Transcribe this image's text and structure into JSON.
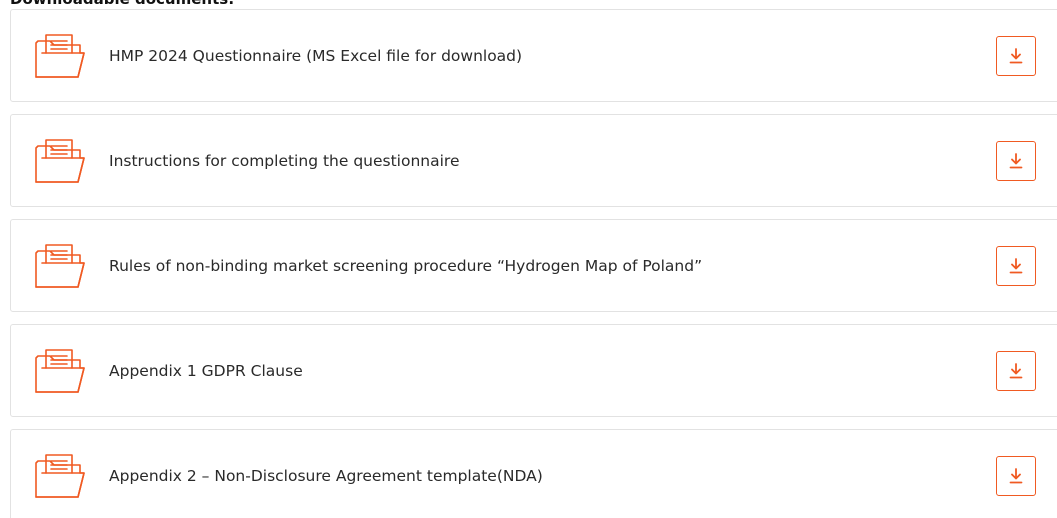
{
  "section": {
    "heading": "Downloadable documents:"
  },
  "theme": {
    "accent": "#f05a22",
    "border": "#e2e2e2"
  },
  "documents": [
    {
      "title": "HMP 2024 Questionnaire (MS Excel file for download)",
      "icon": "folder-document-icon",
      "action_icon": "download-icon"
    },
    {
      "title": "Instructions for completing the questionnaire",
      "icon": "folder-document-icon",
      "action_icon": "download-icon"
    },
    {
      "title": "Rules of non-binding market screening procedure “Hydrogen Map of Poland”",
      "icon": "folder-document-icon",
      "action_icon": "download-icon"
    },
    {
      "title": "Appendix 1 GDPR Clause",
      "icon": "folder-document-icon",
      "action_icon": "download-icon"
    },
    {
      "title": "Appendix 2 – Non-Disclosure Agreement template(NDA)",
      "icon": "folder-document-icon",
      "action_icon": "download-icon"
    }
  ]
}
